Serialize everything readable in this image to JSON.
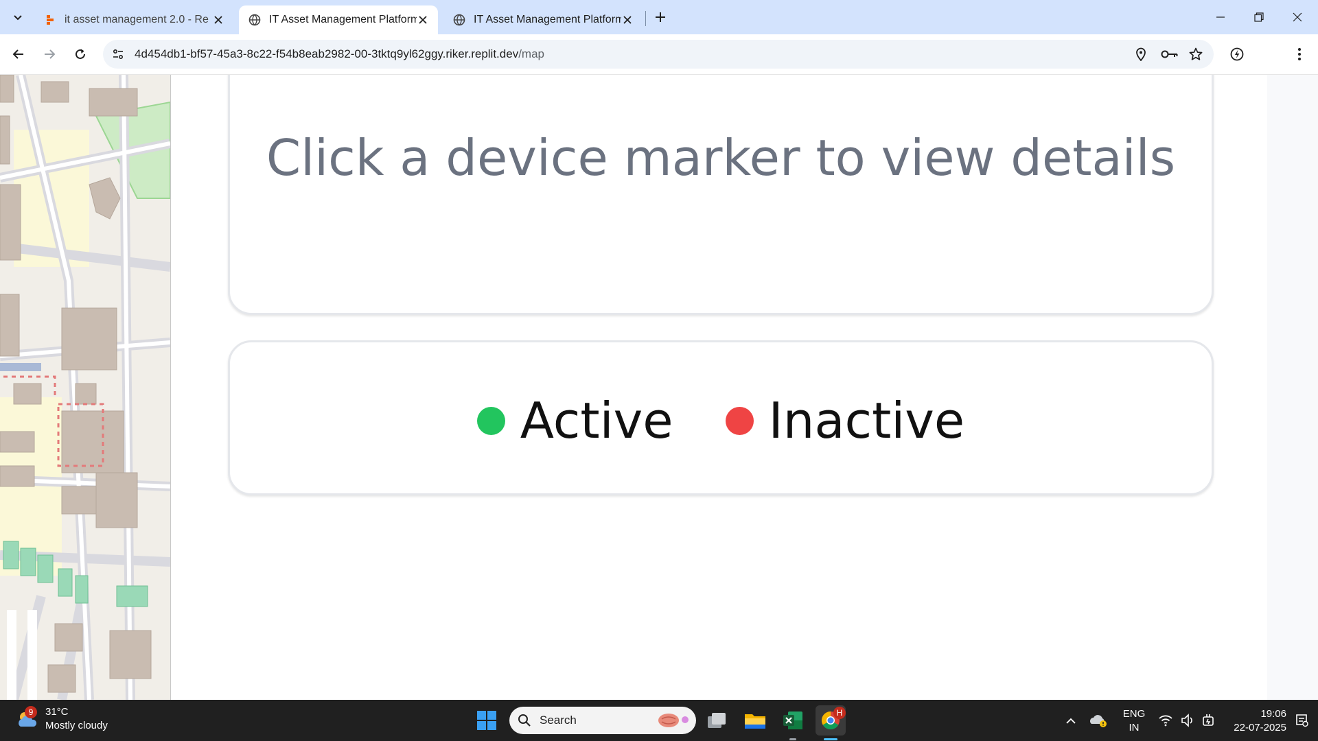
{
  "browser": {
    "tabs": [
      {
        "title": "it asset management 2.0 - Replit",
        "active": false
      },
      {
        "title": "IT Asset Management Platform",
        "active": true
      },
      {
        "title": "IT Asset Management Platform",
        "active": false
      }
    ],
    "url_host": "4d454db1-bf57-45a3-8c22-f54b8eab2982-00-3tktq9yl62ggy.riker.replit.dev",
    "url_path": "/map",
    "profile_initial": "H"
  },
  "page": {
    "details_placeholder": "Click a device marker to view details",
    "legend": [
      {
        "label": "Active",
        "color": "#22c55e"
      },
      {
        "label": "Inactive",
        "color": "#ef4444"
      }
    ]
  },
  "taskbar": {
    "weather_badge": "9",
    "temperature": "31°C",
    "condition": "Mostly cloudy",
    "search_placeholder": "Search",
    "chrome_badge": "H",
    "lang_line1": "ENG",
    "lang_line2": "IN",
    "time": "19:06",
    "date": "22-07-2025"
  }
}
